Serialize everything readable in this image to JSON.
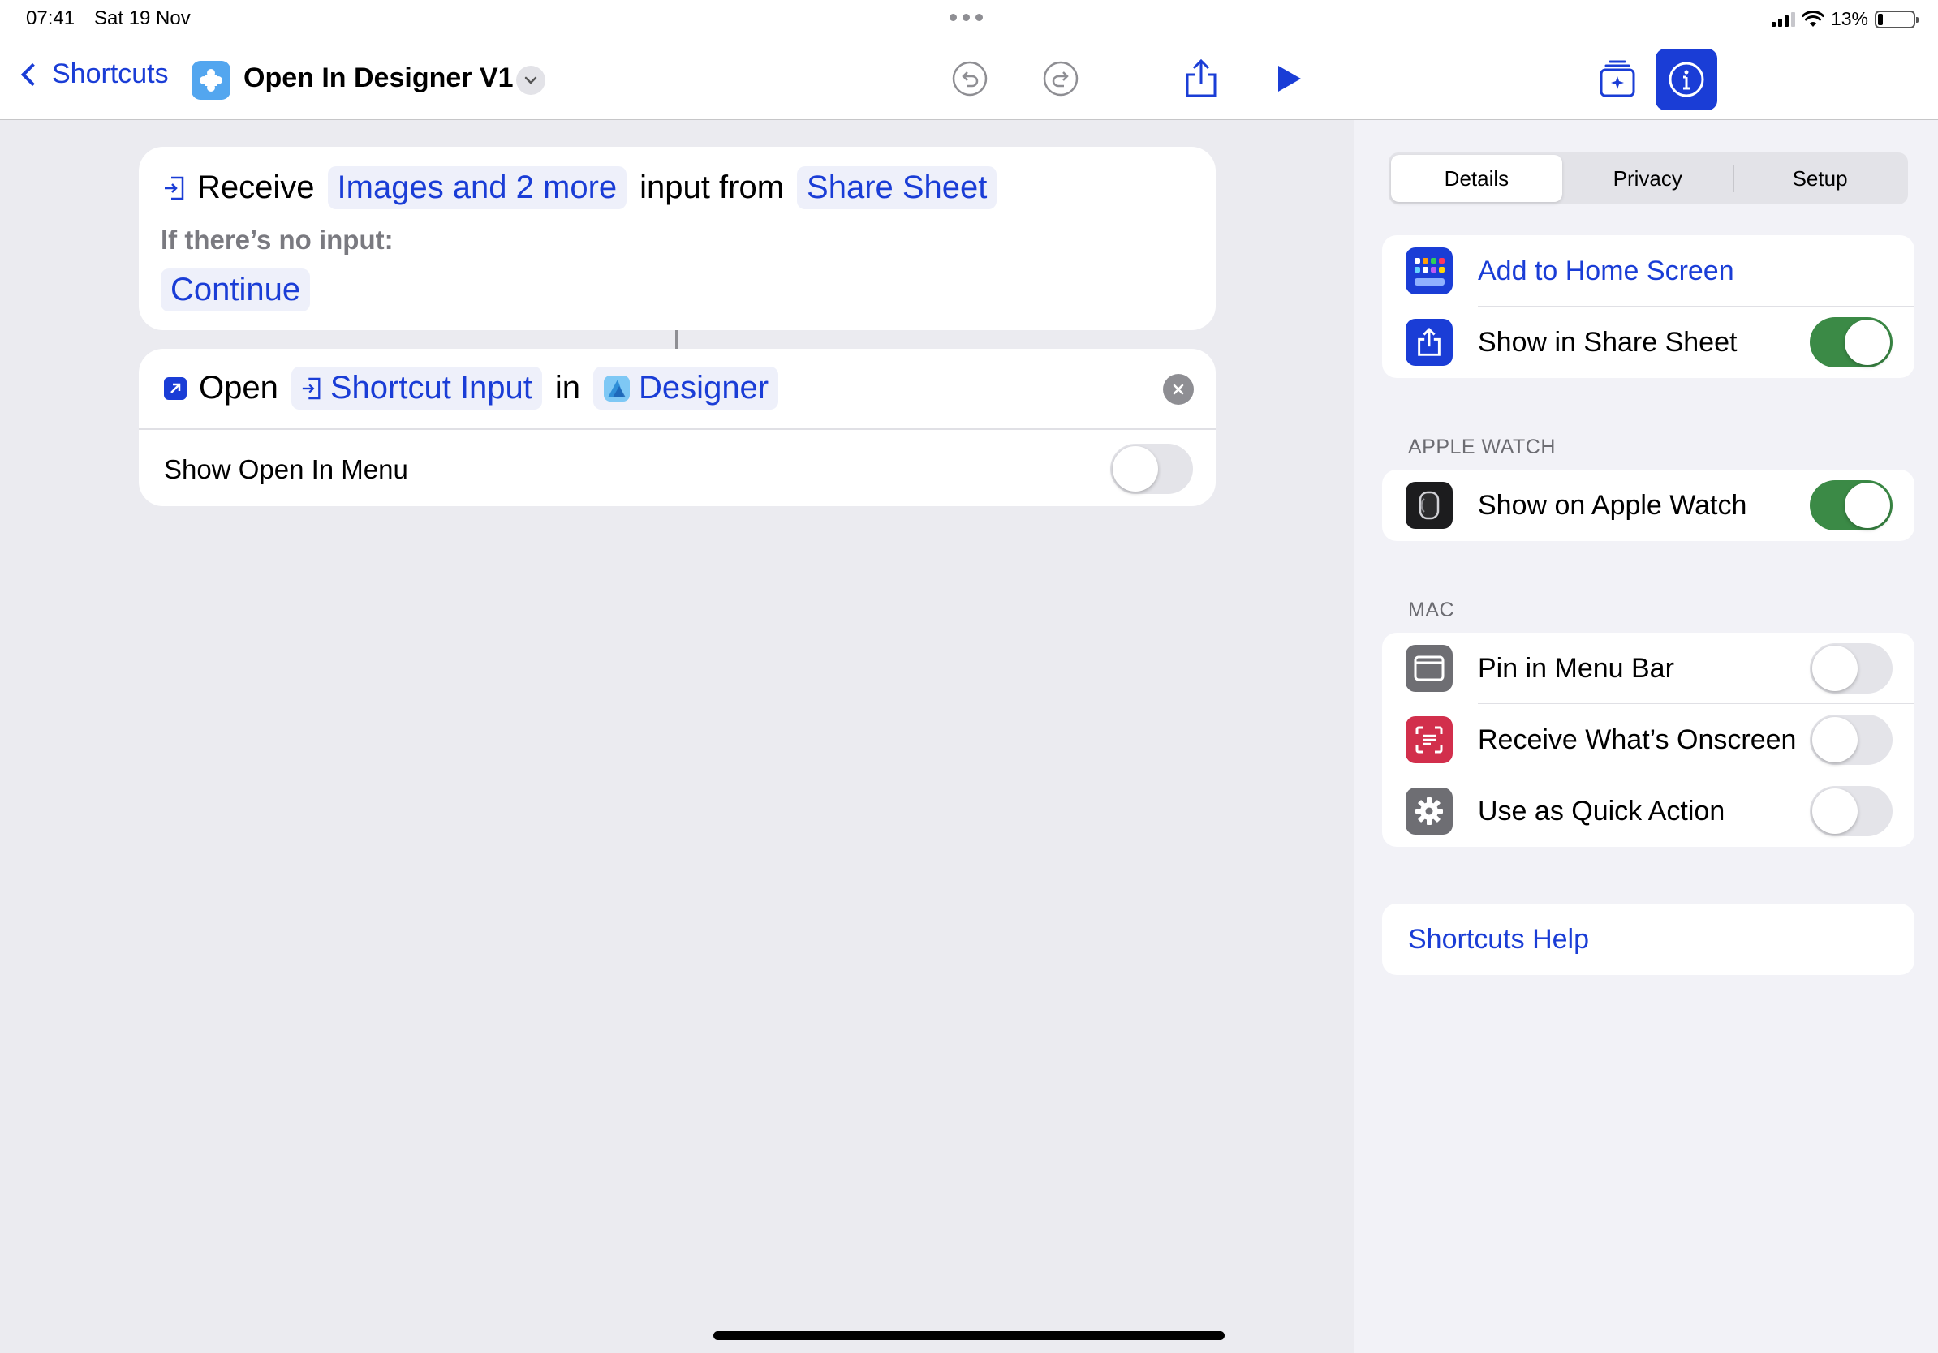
{
  "status_bar": {
    "time": "07:41",
    "date": "Sat 19 Nov",
    "battery": "13%"
  },
  "nav": {
    "back_label": "Shortcuts",
    "title": "Open In Designer V1"
  },
  "action_receive": {
    "verb": "Receive",
    "input_types": "Images and 2 more",
    "connector": "input from",
    "source": "Share Sheet",
    "no_input_label": "If there’s no input:",
    "no_input_action": "Continue"
  },
  "action_open": {
    "verb": "Open",
    "input": "Shortcut Input",
    "connector": "in",
    "app": "Designer",
    "option_label": "Show Open In Menu",
    "option_on": false
  },
  "inspector": {
    "tabs": [
      {
        "label": "Details",
        "active": true
      },
      {
        "label": "Privacy",
        "active": false
      },
      {
        "label": "Setup",
        "active": false
      }
    ],
    "general": [
      {
        "label": "Add to Home Screen",
        "icon": "home-screen-icon",
        "link": true
      },
      {
        "label": "Show in Share Sheet",
        "icon": "share-sheet-icon",
        "on": true
      }
    ],
    "watch_header": "APPLE WATCH",
    "watch": [
      {
        "label": "Show on Apple Watch",
        "icon": "apple-watch-icon",
        "on": true
      }
    ],
    "mac_header": "MAC",
    "mac": [
      {
        "label": "Pin in Menu Bar",
        "icon": "menu-bar-icon",
        "on": false
      },
      {
        "label": "Receive What’s Onscreen",
        "icon": "onscreen-icon",
        "on": false
      },
      {
        "label": "Use as Quick Action",
        "icon": "gear-icon",
        "on": false
      }
    ],
    "help_label": "Shortcuts Help"
  },
  "colors": {
    "accent": "#1a3dd6",
    "toggle_on": "#3b8a46",
    "toggle_off": "#e4e4e9",
    "shortcut_icon": "#53a6ef",
    "onscreen_icon": "#d22f4c"
  }
}
